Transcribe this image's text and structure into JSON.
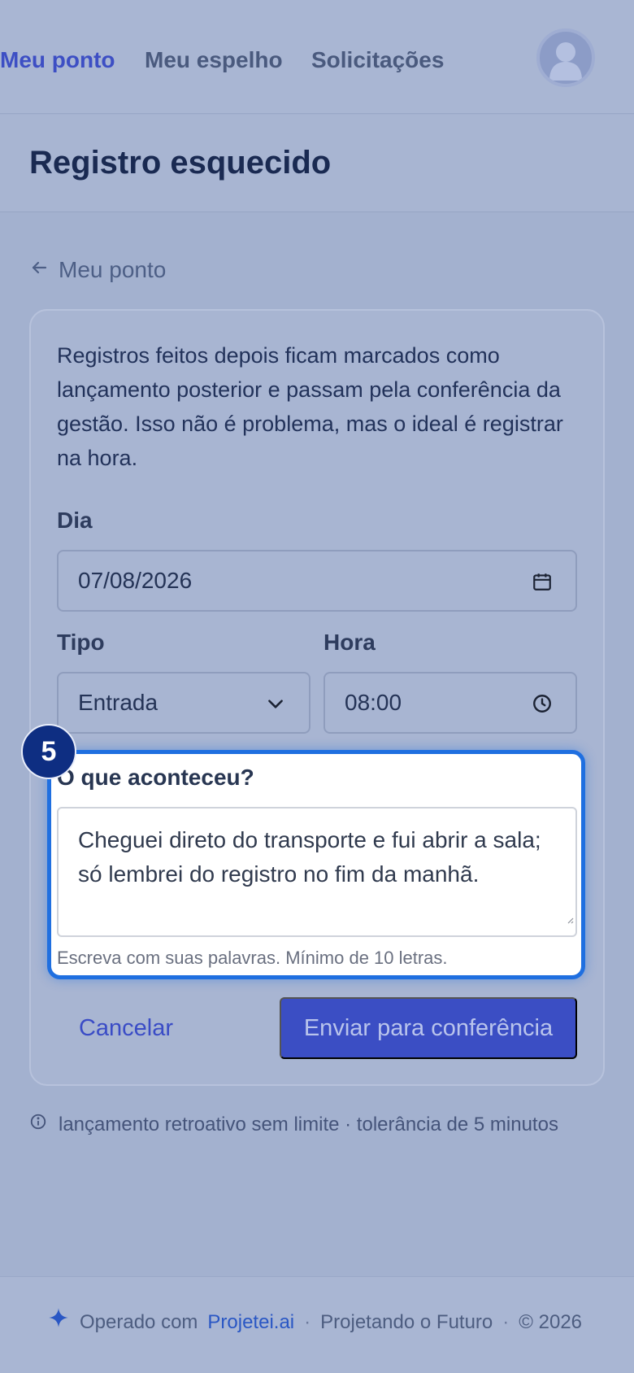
{
  "nav": {
    "items": [
      {
        "label": "Meu ponto",
        "active": true
      },
      {
        "label": "Meu espelho",
        "active": false
      },
      {
        "label": "Solicitações",
        "active": false
      }
    ],
    "avatar_icon": "user-avatar-icon"
  },
  "page": {
    "title": "Registro esquecido",
    "back_label": "Meu ponto",
    "back_icon": "arrow-left-icon"
  },
  "form": {
    "intro": "Registros feitos depois ficam marcados como lançamento posterior e passam pela conferência da gestão. Isso não é problema, mas o ideal é registrar na hora.",
    "day": {
      "label": "Dia",
      "value": "07/08/2026",
      "icon": "calendar-icon"
    },
    "type": {
      "label": "Tipo",
      "value": "Entrada",
      "icon": "chevron-down-icon"
    },
    "hour": {
      "label": "Hora",
      "value": "08:00",
      "icon": "clock-icon"
    },
    "reason": {
      "step": "5",
      "label": "O que aconteceu?",
      "value": "Cheguei direto do transporte e fui abrir a sala; só lembrei do registro no fim da manhã.",
      "hint": "Escreva com suas palavras. Mínimo de 10 letras."
    },
    "cancel_label": "Cancelar",
    "submit_label": "Enviar para conferência"
  },
  "info": {
    "icon": "info-icon",
    "text": "lançamento retroativo sem limite · tolerância de 5 minutos"
  },
  "footer": {
    "icon": "sparkle-icon",
    "operated": "Operado com",
    "brand": "Projetei.ai",
    "sep": "·",
    "tagline": "Projetando o Futuro",
    "copyright": "© 2026"
  },
  "colors": {
    "accent": "#3b4ec4",
    "highlight_border": "#1f6fe0",
    "badge": "#0e2e82"
  }
}
